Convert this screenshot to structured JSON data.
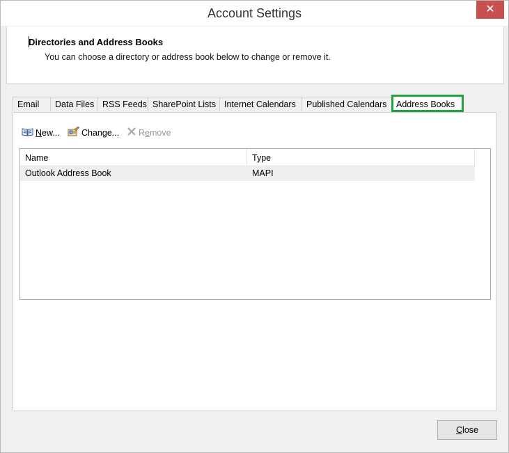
{
  "window": {
    "title": "Account Settings",
    "close_glyph": "✕"
  },
  "header": {
    "title": "Directories and Address Books",
    "subtitle": "You can choose a directory or address book below to change or remove it."
  },
  "tabs": [
    {
      "label": "Email"
    },
    {
      "label": "Data Files"
    },
    {
      "label": "RSS Feeds"
    },
    {
      "label": "SharePoint Lists"
    },
    {
      "label": "Internet Calendars"
    },
    {
      "label": "Published Calendars"
    },
    {
      "label": "Address Books",
      "active": true,
      "highlight_color": "#22a340"
    }
  ],
  "toolbar": {
    "new": {
      "label_u": "N",
      "label_rest": "ew...",
      "icon": "address-book-icon"
    },
    "change": {
      "label_u": "",
      "label_pre": "Change...",
      "icon": "edit-card-icon"
    },
    "remove": {
      "label_pre": "R",
      "label_u": "e",
      "label_rest": "move",
      "icon": "x-icon",
      "disabled": true
    }
  },
  "list": {
    "columns": [
      "Name",
      "Type"
    ],
    "rows": [
      {
        "name": "Outlook Address Book",
        "type": "MAPI"
      }
    ]
  },
  "footer": {
    "close_u": "C",
    "close_rest": "lose"
  }
}
